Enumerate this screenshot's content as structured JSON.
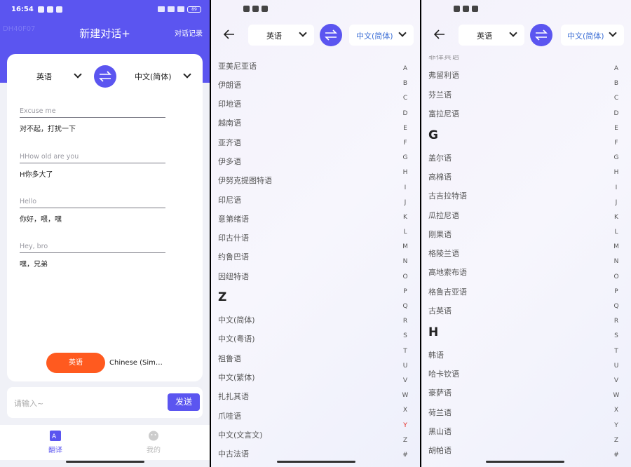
{
  "phone1": {
    "status_time": "16:54",
    "battery": "89",
    "ghost_text": "DH40F07",
    "title": "新建对话+",
    "history": "对话记录",
    "source_lang": "英语",
    "target_lang": "中文(简体)",
    "messages": [
      {
        "src": "Excuse me",
        "dst": "对不起，打扰一下"
      },
      {
        "src": "HHow old are you",
        "dst": "H你多大了"
      },
      {
        "src": "Hello",
        "dst": "你好，喂，嘿"
      },
      {
        "src": "Hey, bro",
        "dst": "嘿，兄弟"
      }
    ],
    "speak_button": "英语",
    "speak_other": "Chinese (Sim…",
    "input_placeholder": "请输入~",
    "send": "发送",
    "tabs": [
      {
        "label": "翻译",
        "color": "#5b55f0"
      },
      {
        "label": "我的",
        "color": "#bbbbbb"
      }
    ]
  },
  "phone2": {
    "source_lang": "英语",
    "target_lang": "中文(简体)",
    "items_top": [
      "亚美尼亚语",
      "伊朗语",
      "印地语",
      "越南语",
      "亚齐语",
      "伊多语",
      "伊努克提图特语",
      "印尼语",
      "意第绪语",
      "印古什语",
      "约鲁巴语",
      "因纽特语"
    ],
    "section_z": "Z",
    "items_z": [
      "中文(简体)",
      "中文(粤语)",
      "祖鲁语",
      "中文(繁体)",
      "扎扎其语",
      "爪哇语",
      "中文(文言文)",
      "中古法语"
    ]
  },
  "phone3": {
    "source_lang": "英语",
    "target_lang": "中文(简体)",
    "item_partial": "菲律宾语",
    "items_f": [
      "弗留利语",
      "芬兰语",
      "富拉尼语"
    ],
    "section_g": "G",
    "items_g": [
      "盖尔语",
      "高棉语",
      "古吉拉特语",
      "瓜拉尼语",
      "刚果语",
      "格陵兰语",
      "高地索布语",
      "格鲁吉亚语",
      "古英语"
    ],
    "section_h": "H",
    "items_h": [
      "韩语",
      "哈卡钦语",
      "豪萨语",
      "荷兰语",
      "黑山语",
      "胡帕语"
    ]
  },
  "index_letters": [
    "A",
    "B",
    "C",
    "D",
    "E",
    "F",
    "G",
    "H",
    "I",
    "J",
    "K",
    "L",
    "M",
    "N",
    "O",
    "P",
    "Q",
    "R",
    "S",
    "T",
    "U",
    "V",
    "W",
    "X",
    "Y",
    "Z",
    "#"
  ],
  "index_highlight_phone2": "Y",
  "colors": {
    "accent": "#5b55f0",
    "orange": "#ff5a1f",
    "highlight": "#e5261f"
  }
}
